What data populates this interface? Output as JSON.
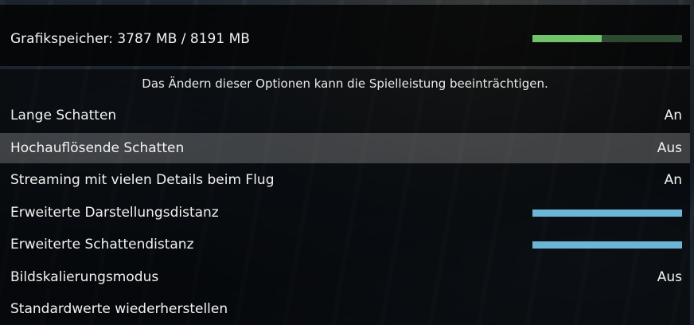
{
  "memory": {
    "label": "Grafikspeicher: 3787 MB / 8191 MB",
    "used_fraction": 0.462
  },
  "notice": "Das Ändern dieser Optionen kann die Spielleistung beeinträchtigen.",
  "options": [
    {
      "label": "Lange Schatten",
      "value": "An"
    },
    {
      "label": "Hochauflösende Schatten",
      "value": "Aus",
      "selected": true
    },
    {
      "label": "Streaming mit vielen Details beim Flug",
      "value": "An"
    },
    {
      "label": "Erweiterte Darstellungsdistanz",
      "slider_level": 1.0
    },
    {
      "label": "Erweiterte Schattendistanz",
      "slider_level": 1.0
    },
    {
      "label": "Bildskalierungsmodus",
      "value": "Aus"
    },
    {
      "label": "Standardwerte wiederherstellen"
    }
  ],
  "colors": {
    "memory_fill": "#72c46a",
    "slider_fill": "#6bb5d6",
    "selected_row": "rgba(255,255,255,0.22)"
  }
}
